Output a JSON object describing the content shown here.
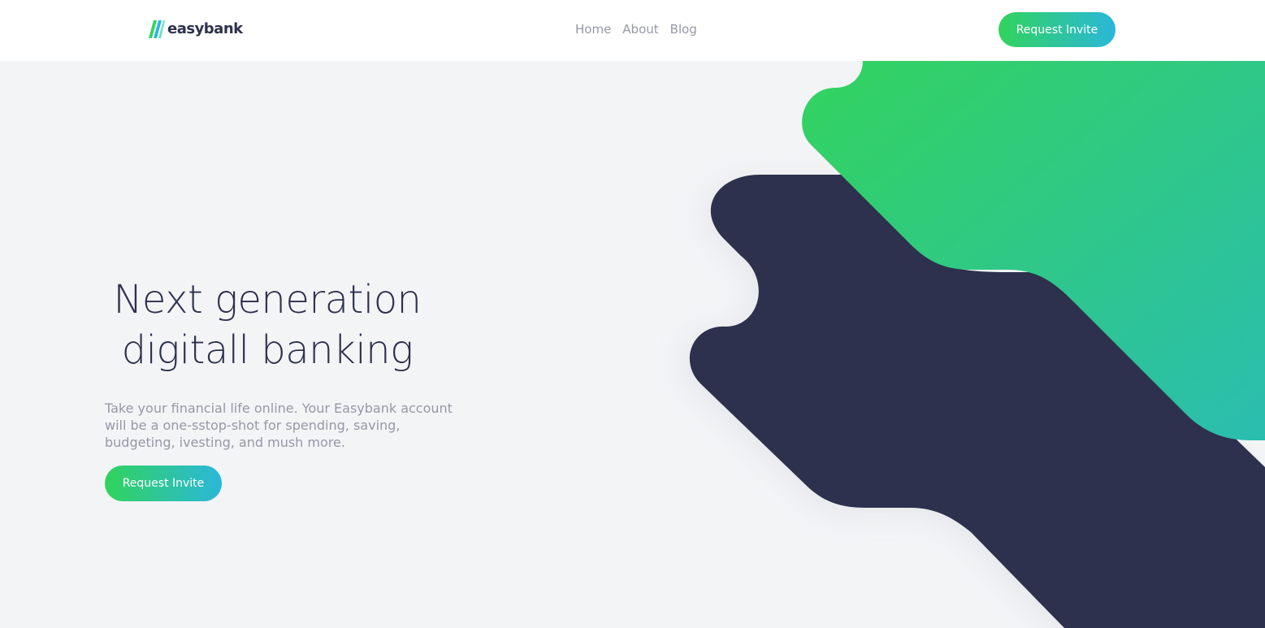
{
  "header": {
    "logo_text": "easybank",
    "nav": [
      "Home",
      "About",
      "Blog"
    ],
    "cta_label": "Request Invite"
  },
  "hero": {
    "title_line1": "Next generation",
    "title_line2": "digitall banking",
    "description": "Take your financial life online. Your Easybank account will be a one-sstop-shot for spending, saving, budgeting, ivesting, and mush more.",
    "cta_label": "Request Invite"
  },
  "colors": {
    "dark_blue": "#2d314d",
    "lime_green": "#31d35c",
    "bright_cyan": "#2bb7da",
    "grayish_blue": "#9698a6",
    "light_gray_bg": "#f3f4f6",
    "white": "#ffffff"
  }
}
